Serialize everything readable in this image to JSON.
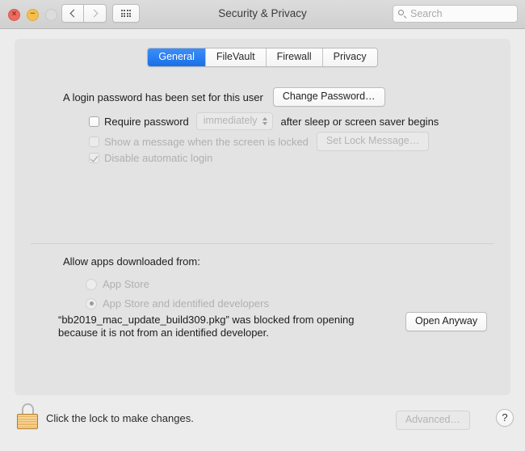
{
  "window": {
    "title": "Security & Privacy",
    "traffic_lights": [
      {
        "name": "close",
        "glyph": "×"
      },
      {
        "name": "minimize",
        "glyph": "−"
      },
      {
        "name": "zoom",
        "glyph": ""
      }
    ]
  },
  "toolbar": {
    "back_label": "‹",
    "forward_label": "›",
    "show_all_label": "grid-icon",
    "search": {
      "placeholder": "Search",
      "value": "",
      "icon": "search-icon"
    }
  },
  "tabs": [
    {
      "label": "General",
      "active": true
    },
    {
      "label": "FileVault",
      "active": false
    },
    {
      "label": "Firewall",
      "active": false
    },
    {
      "label": "Privacy",
      "active": false
    }
  ],
  "general": {
    "login_password_text": "A login password has been set for this user",
    "change_password_label": "Change Password…",
    "require_password": {
      "checked": false,
      "enabled": true,
      "label": "Require password",
      "delay_value": "immediately",
      "delay_enabled": false,
      "suffix": "after sleep or screen saver begins"
    },
    "show_message": {
      "checked": false,
      "enabled": false,
      "label": "Show a message when the screen is locked",
      "button_label": "Set Lock Message…"
    },
    "disable_auto_login": {
      "checked": true,
      "enabled": false,
      "label": "Disable automatic login"
    },
    "allow_apps_label": "Allow apps downloaded from:",
    "allow_options": [
      {
        "label": "App Store",
        "selected": false,
        "enabled": false
      },
      {
        "label": "App Store and identified developers",
        "selected": true,
        "enabled": false
      }
    ],
    "blocked_notice": "“bb2019_mac_update_build309.pkg” was blocked from opening because it is not from an identified developer.",
    "open_anyway_label": "Open Anyway"
  },
  "footer": {
    "lock_icon": "lock-closed-icon",
    "lock_text": "Click the lock to make changes.",
    "advanced_label": "Advanced…",
    "advanced_enabled": false,
    "help_label": "?"
  },
  "colors": {
    "accent": "#1a6fe8",
    "window_bg": "#ececec",
    "content_bg": "#e3e3e3",
    "lock_gold": "#e8b766",
    "disabled_text": "#b0b0b0"
  }
}
